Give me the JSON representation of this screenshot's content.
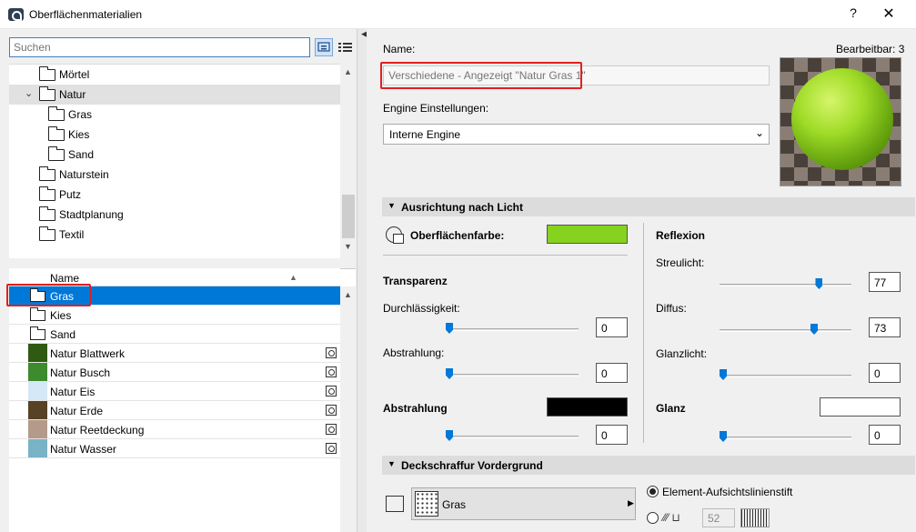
{
  "window": {
    "title": "Oberflächenmaterialien",
    "help": "?",
    "close": "✕"
  },
  "search": {
    "placeholder": "Suchen",
    "value": ""
  },
  "tree": {
    "items": [
      {
        "label": "Mörtel",
        "level": 1,
        "expanded": false
      },
      {
        "label": "Natur",
        "level": 1,
        "expanded": true,
        "selected": true
      },
      {
        "label": "Gras",
        "level": 2
      },
      {
        "label": "Kies",
        "level": 2
      },
      {
        "label": "Sand",
        "level": 2
      },
      {
        "label": "Naturstein",
        "level": 1
      },
      {
        "label": "Putz",
        "level": 1
      },
      {
        "label": "Stadtplanung",
        "level": 1
      },
      {
        "label": "Textil",
        "level": 1
      }
    ],
    "expand_glyph": "⌄"
  },
  "list": {
    "header": "Name",
    "sort_glyph": "▲",
    "rows": [
      {
        "label": "Gras",
        "type": "folder",
        "selected": true
      },
      {
        "label": "Kies",
        "type": "folder"
      },
      {
        "label": "Sand",
        "type": "folder"
      },
      {
        "label": "Natur Blattwerk",
        "type": "material",
        "color": "#2e5a12"
      },
      {
        "label": "Natur Busch",
        "type": "material",
        "color": "#3e8a2e"
      },
      {
        "label": "Natur Eis",
        "type": "material",
        "color": "#d4e8f7"
      },
      {
        "label": "Natur Erde",
        "type": "material",
        "color": "#574226"
      },
      {
        "label": "Natur Reetdeckung",
        "type": "material",
        "color": "#b49a8a"
      },
      {
        "label": "Natur Wasser",
        "type": "material",
        "color": "#7ab2c6"
      }
    ]
  },
  "detail": {
    "name_label": "Name:",
    "editable_label": "Bearbeitbar: 3",
    "name_value": "Verschiedene - Angezeigt \"Natur Gras 1\"",
    "engine_label": "Engine Einstellungen:",
    "engine_value": "Interne Engine",
    "section_light": "Ausrichtung nach Licht",
    "surface_color_label": "Oberflächenfarbe:",
    "surface_color": "#85d21f",
    "transparency_label": "Transparenz",
    "durchlaessigkeit_label": "Durchlässigkeit:",
    "durchlaessigkeit_value": "0",
    "durchlaessigkeit_level": 0,
    "abstrahlung_t_label": "Abstrahlung:",
    "abstrahlung_t_value": "0",
    "abstrahlung_t_level": 0,
    "abstrahlung_label": "Abstrahlung",
    "abstrahlung_color": "#000000",
    "abstrahlung_value": "0",
    "abstrahlung_level": 0,
    "reflexion_label": "Reflexion",
    "streulicht_label": "Streulicht:",
    "streulicht_value": "77",
    "streulicht_level": 77,
    "diffus_label": "Diffus:",
    "diffus_value": "73",
    "diffus_level": 73,
    "glanzlicht_label": "Glanzlicht:",
    "glanzlicht_value": "0",
    "glanzlicht_level": 0,
    "glanz_label": "Glanz",
    "glanz_color": "#ffffff",
    "glanz_value": "0",
    "glanz_level": 0,
    "section_hatch": "Deckschraffur Vordergrund",
    "hatch_value": "Gras",
    "pen_option_label": "Element-Aufsichtslinienstift",
    "pen_number": "52"
  }
}
